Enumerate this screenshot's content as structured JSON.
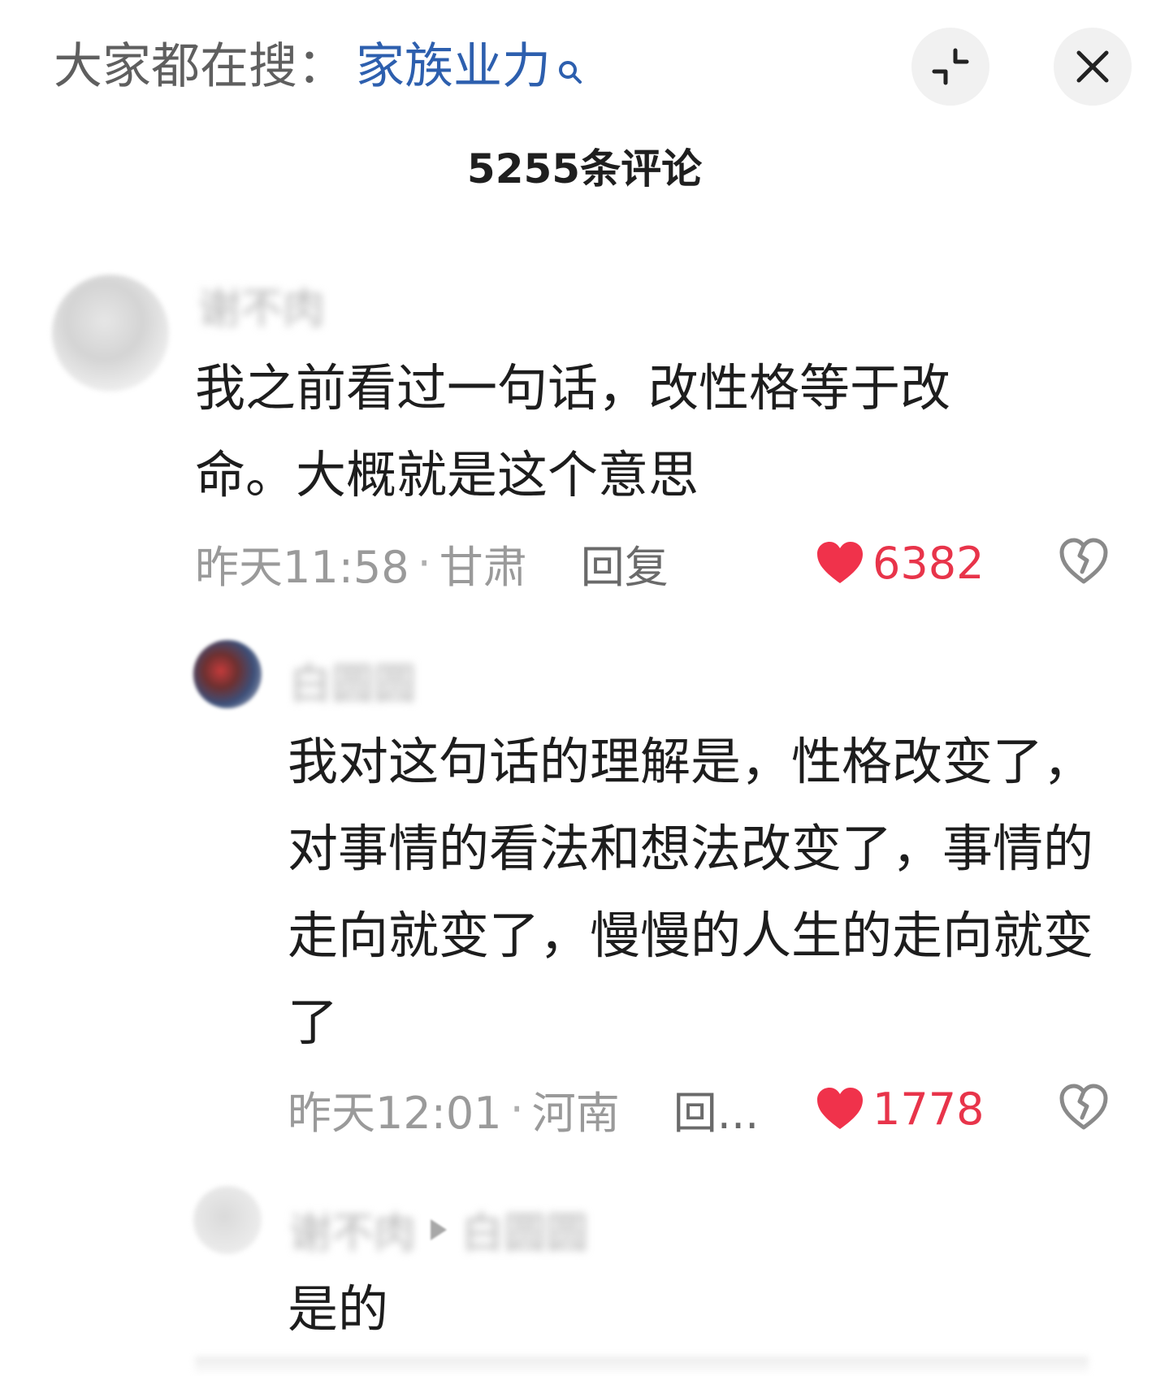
{
  "header": {
    "search_prefix": "大家都在搜：",
    "search_query": "家族业力",
    "query_icon": "search-icon",
    "minimize_icon": "collapse-icon",
    "close_icon": "close-icon"
  },
  "comment_count": "5255条评论",
  "comments": [
    {
      "username": "谢不肉",
      "text": "我之前看过一句话，改性格等于改命。大概就是这个意思",
      "time": "昨天11:58",
      "location": "甘肃",
      "reply_label": "回复",
      "likes": "6382"
    },
    {
      "username": "白圆圆",
      "text": "我对这句话的理解是，性格改变了，对事情的看法和想法改变了，事情的走向就变了，慢慢的人生的走向就变了",
      "time": "昨天12:01",
      "location": "河南",
      "reply_label": "回...",
      "likes": "1778"
    },
    {
      "from_user": "谢不肉",
      "to_user": "白圆圆",
      "text": "是的"
    }
  ],
  "meta_separator": "·",
  "colors": {
    "accent_query": "#2d5fae",
    "like_red": "#e8344a",
    "meta_gray": "#9a9a9a"
  }
}
